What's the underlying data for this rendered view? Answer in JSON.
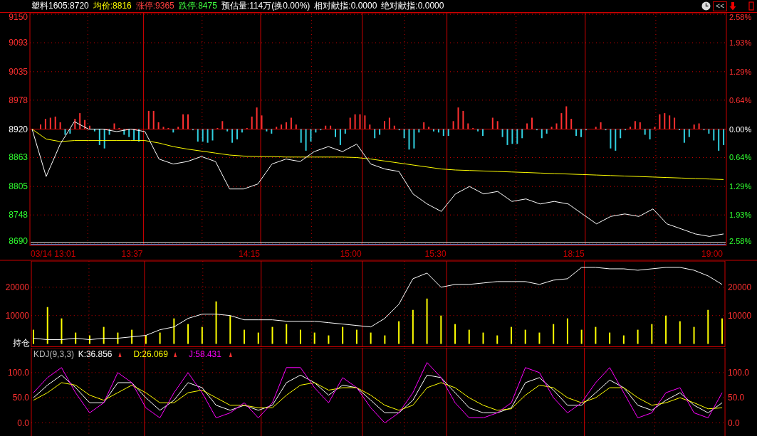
{
  "header": {
    "items": [
      {
        "text": "塑料1605:8720"
      },
      {
        "text": "均价:8816",
        "color": "#ffff00"
      },
      {
        "text": "涨停:9365",
        "color": "#ff4040"
      },
      {
        "text": "跌停:8475",
        "color": "#40ff40"
      },
      {
        "text": "预估量:114万(换0.00%)"
      },
      {
        "text": "相对献指:0.0000"
      },
      {
        "text": "绝对献指:0.0000"
      }
    ],
    "collapse_button": "<<"
  },
  "price_panel": {
    "right_axis": [
      {
        "label": "2.58%",
        "kind": "up"
      },
      {
        "label": "1.93%",
        "kind": "up"
      },
      {
        "label": "1.29%",
        "kind": "up"
      },
      {
        "label": "0.64%",
        "kind": "up"
      },
      {
        "label": "0.00%",
        "kind": "flat"
      },
      {
        "label": "0.64%",
        "kind": "down"
      },
      {
        "label": "1.29%",
        "kind": "down"
      },
      {
        "label": "1.93%",
        "kind": "down"
      },
      {
        "label": "2.58%",
        "kind": "down"
      }
    ],
    "time_axis": [
      "03/14 13:01",
      "13:37",
      "14:15",
      "15:00",
      "15:30",
      "18:15",
      "19:00"
    ],
    "chart_data": {
      "type": "line",
      "grid": true,
      "ylim": [
        8687,
        9153
      ],
      "yticks": [
        {
          "value": 9150,
          "label": "9150"
        },
        {
          "value": 9093,
          "label": "9093"
        },
        {
          "value": 9035,
          "label": "9035"
        },
        {
          "value": 8978,
          "label": "8978"
        },
        {
          "value": 8920,
          "label": "8920"
        },
        {
          "value": 8863,
          "label": "8863"
        },
        {
          "value": 8805,
          "label": "8805"
        },
        {
          "value": 8748,
          "label": "8748"
        },
        {
          "value": 8690,
          "label": "8690"
        }
      ],
      "series": [
        {
          "color": "#ffffff",
          "values": [
            8920,
            8825,
            8890,
            8935,
            8920,
            8920,
            8915,
            8920,
            8915,
            8860,
            8850,
            8855,
            8865,
            8855,
            8800,
            8800,
            8810,
            8850,
            8860,
            8855,
            8875,
            8885,
            8875,
            8890,
            8850,
            8840,
            8835,
            8790,
            8770,
            8755,
            8790,
            8805,
            8790,
            8795,
            8775,
            8780,
            8770,
            8775,
            8770,
            8750,
            8730,
            8745,
            8750,
            8745,
            8760,
            8730,
            8720,
            8710,
            8705,
            8710
          ]
        },
        {
          "color": "#ffff00",
          "values": [
            8920,
            8900,
            8895,
            8897,
            8897,
            8897,
            8897,
            8897,
            8897,
            8892,
            8885,
            8880,
            8876,
            8872,
            8868,
            8866,
            8865,
            8865,
            8864,
            8864,
            8864,
            8864,
            8864,
            8863,
            8860,
            8856,
            8852,
            8848,
            8844,
            8840,
            8838,
            8837,
            8836,
            8835,
            8834,
            8833,
            8832,
            8831,
            8830,
            8829,
            8828,
            8827,
            8826,
            8825,
            8824,
            8823,
            8822,
            8821,
            8820,
            8819
          ]
        }
      ]
    }
  },
  "volume_panel": {
    "label": "持仓",
    "chart_data": {
      "type": "bar",
      "grid": true,
      "ylim": [
        -1000,
        29250
      ],
      "yticks": [
        {
          "value": 10000,
          "label": "10000"
        },
        {
          "value": 20000,
          "label": "20000"
        }
      ],
      "series": [
        {
          "color": "#ffff00",
          "values": [
            5000,
            13000,
            9000,
            4000,
            3000,
            6000,
            4000,
            5000,
            3000,
            4000,
            9000,
            7000,
            6000,
            15000,
            10000,
            5000,
            4000,
            6000,
            7000,
            5000,
            4000,
            3000,
            6000,
            5000,
            4000,
            3000,
            8000,
            12000,
            16000,
            10000,
            7000,
            5000,
            4000,
            3000,
            6000,
            5000,
            4000,
            7000,
            9000,
            5000,
            6000,
            4000,
            3000,
            5000,
            7000,
            10000,
            8000,
            6000,
            12000,
            9000
          ]
        },
        {
          "type": "line",
          "color": "#ffffff",
          "values": [
            2000,
            1500,
            1500,
            2000,
            1500,
            2000,
            2000,
            2500,
            3000,
            5000,
            6000,
            9000,
            10500,
            10500,
            10000,
            8500,
            8500,
            8500,
            8000,
            8000,
            8000,
            7500,
            7000,
            6500,
            6000,
            9000,
            14000,
            23000,
            25000,
            20000,
            21000,
            21000,
            21500,
            22000,
            22000,
            22000,
            21000,
            22500,
            23000,
            27000,
            27000,
            26500,
            26500,
            26000,
            26500,
            27000,
            27000,
            26000,
            24000,
            21000
          ]
        }
      ]
    }
  },
  "kdj_panel": {
    "title": "KDJ(9,3,3)",
    "readouts": [
      {
        "text": "K:36.856",
        "color": "#ffffff"
      },
      {
        "text": "D:26.069",
        "color": "#ffff00"
      },
      {
        "text": "J:58.431",
        "color": "#ff00ff"
      }
    ],
    "chart_data": {
      "type": "line",
      "grid": true,
      "ylim": [
        -26.8,
        149.3
      ],
      "yticks": [
        {
          "value": 0,
          "label": "0.0"
        },
        {
          "value": 50,
          "label": "50.0"
        },
        {
          "value": 100,
          "label": "100.0"
        }
      ],
      "series": [
        {
          "color": "#ffffff",
          "values": [
            50,
            75,
            95,
            70,
            40,
            40,
            80,
            80,
            50,
            25,
            45,
            80,
            70,
            35,
            25,
            35,
            25,
            35,
            80,
            95,
            80,
            55,
            75,
            70,
            45,
            20,
            20,
            45,
            95,
            90,
            60,
            30,
            20,
            20,
            30,
            80,
            90,
            65,
            35,
            35,
            60,
            85,
            70,
            35,
            25,
            45,
            60,
            35,
            20,
            40
          ]
        },
        {
          "color": "#ffff00",
          "values": [
            45,
            60,
            80,
            75,
            55,
            45,
            60,
            75,
            60,
            40,
            40,
            60,
            65,
            50,
            35,
            35,
            30,
            30,
            55,
            75,
            80,
            65,
            70,
            70,
            55,
            35,
            25,
            35,
            70,
            80,
            70,
            50,
            35,
            25,
            28,
            55,
            75,
            70,
            50,
            40,
            50,
            70,
            70,
            50,
            35,
            40,
            50,
            40,
            28,
            30
          ]
        },
        {
          "color": "#ff00ff",
          "values": [
            60,
            90,
            110,
            60,
            20,
            40,
            100,
            80,
            30,
            10,
            60,
            100,
            60,
            10,
            20,
            40,
            10,
            40,
            110,
            110,
            70,
            40,
            90,
            70,
            30,
            0,
            20,
            60,
            120,
            90,
            40,
            10,
            10,
            20,
            40,
            110,
            100,
            50,
            20,
            40,
            80,
            110,
            60,
            10,
            20,
            60,
            70,
            20,
            10,
            60
          ]
        }
      ]
    }
  }
}
